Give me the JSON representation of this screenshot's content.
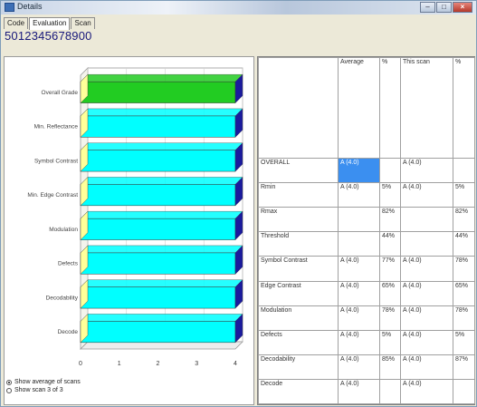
{
  "window": {
    "title": "Details",
    "buttons": [
      "–",
      "□",
      "×"
    ]
  },
  "tabs": [
    {
      "label": "Code",
      "active": false
    },
    {
      "label": "Evaluation",
      "active": true
    },
    {
      "label": "Scan",
      "active": false
    }
  ],
  "code": "5012345678900",
  "chart_data": {
    "type": "bar",
    "orientation": "horizontal",
    "categories": [
      "Overall Grade",
      "Min. Reflectance",
      "Symbol Contrast",
      "Min. Edge Contrast",
      "Modulation",
      "Defects",
      "Decodability",
      "Decode"
    ],
    "values": [
      4,
      4,
      4,
      4,
      4,
      4,
      4,
      4
    ],
    "xlim": [
      0,
      4
    ],
    "xticks": [
      "0",
      "1",
      "2",
      "3",
      "4"
    ],
    "colors": {
      "overall": "#22cc22",
      "other": "#00ffff",
      "side": "#1b1b9e",
      "cap": "#ffff99"
    }
  },
  "options": {
    "average": "Show average of scans",
    "scan": "Show scan 3 of 3",
    "selected": "average"
  },
  "table": {
    "columns": [
      "",
      "Average",
      "%",
      "This scan",
      "%"
    ],
    "rows": [
      {
        "label": "OVERALL",
        "avg": "A (4.0)",
        "avg_pct": "",
        "scan": "A (4.0)",
        "scan_pct": ""
      },
      {
        "label": "Rmin",
        "avg": "A (4.0)",
        "avg_pct": "5%",
        "scan": "A (4.0)",
        "scan_pct": "5%"
      },
      {
        "label": "Rmax",
        "avg": "",
        "avg_pct": "82%",
        "scan": "",
        "scan_pct": "82%"
      },
      {
        "label": "Threshold",
        "avg": "",
        "avg_pct": "44%",
        "scan": "",
        "scan_pct": "44%"
      },
      {
        "label": "Symbol Contrast",
        "avg": "A (4.0)",
        "avg_pct": "77%",
        "scan": "A (4.0)",
        "scan_pct": "78%"
      },
      {
        "label": "Edge Contrast",
        "avg": "A (4.0)",
        "avg_pct": "65%",
        "scan": "A (4.0)",
        "scan_pct": "65%"
      },
      {
        "label": "Modulation",
        "avg": "A (4.0)",
        "avg_pct": "78%",
        "scan": "A (4.0)",
        "scan_pct": "78%"
      },
      {
        "label": "Defects",
        "avg": "A (4.0)",
        "avg_pct": "5%",
        "scan": "A (4.0)",
        "scan_pct": "5%"
      },
      {
        "label": "Decodability",
        "avg": "A (4.0)",
        "avg_pct": "85%",
        "scan": "A (4.0)",
        "scan_pct": "87%"
      },
      {
        "label": "Decode",
        "avg": "A (4.0)",
        "avg_pct": "",
        "scan": "A (4.0)",
        "scan_pct": ""
      }
    ]
  }
}
